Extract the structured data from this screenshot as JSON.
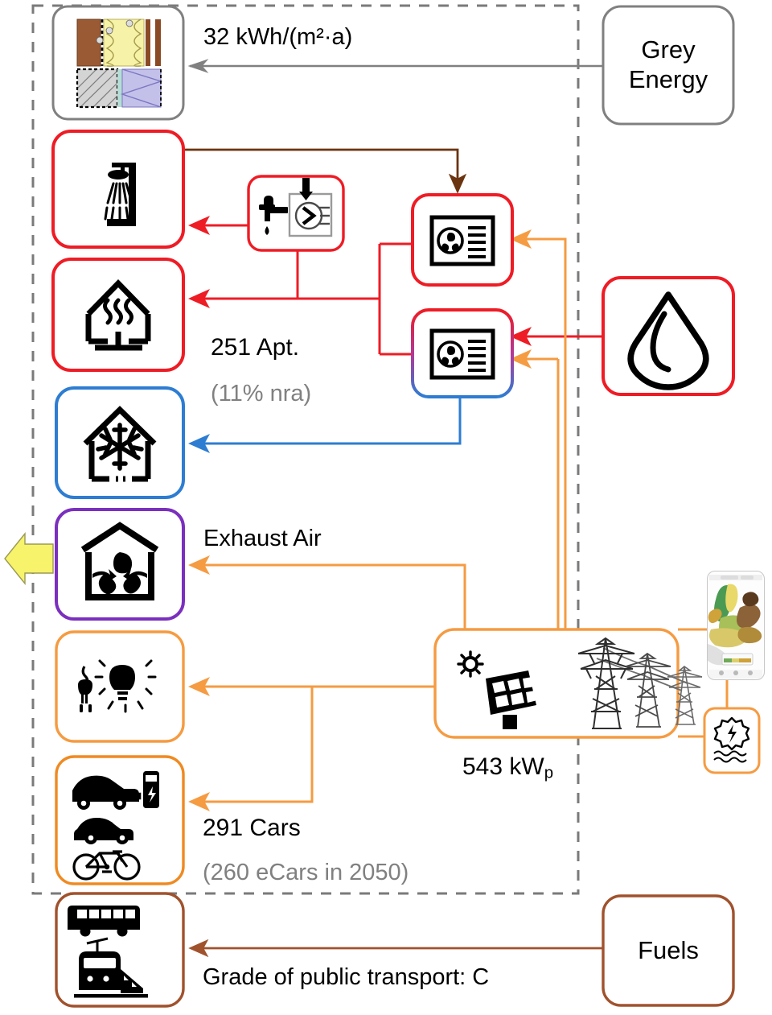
{
  "diagram": {
    "title": "Building energy and mobility flow diagram",
    "system_boundary": "dashed grey rectangle"
  },
  "colors": {
    "red": "#ee1c25",
    "blue": "#2d7dd2",
    "orange": "#f59b42",
    "orange_dark": "#ef8a22",
    "brown": "#a0522d",
    "brown_dark": "#6b3410",
    "purple": "#7b2fbe",
    "grey": "#808080",
    "grey_dash": "#7a7a7a",
    "yellow": "#f7f36b",
    "black": "#000000"
  },
  "labels": {
    "grey_energy_value": "32 kWh/(m²·a)",
    "apartments": "251 Apt.",
    "apartments_note": "(11% nra)",
    "exhaust_air": "Exhaust Air",
    "pv_power": "543 kW",
    "pv_power_sub": "p",
    "cars": "291 Cars",
    "cars_note": "(260 eCars in 2050)",
    "public_transport": "Grade of public transport: C"
  },
  "source_boxes": [
    {
      "id": "grey-energy",
      "label_line1": "Grey",
      "label_line2": "Energy",
      "color": "#808080"
    },
    {
      "id": "fuels",
      "label_line1": "Fuels",
      "label_line2": "",
      "color": "#a0522d"
    }
  ],
  "demand_boxes": [
    {
      "id": "building-envelope",
      "icon": "wall-section-icon",
      "border": "#808080",
      "name": "Building envelope construction"
    },
    {
      "id": "domestic-hot-water",
      "icon": "shower-icon",
      "border": "#ee1c25",
      "name": "Domestic hot water"
    },
    {
      "id": "space-heating",
      "icon": "house-heating-icon",
      "border": "#ee1c25",
      "name": "Space heating"
    },
    {
      "id": "space-cooling",
      "icon": "house-cooling-icon",
      "border": "#2d7dd2",
      "name": "Space cooling"
    },
    {
      "id": "ventilation",
      "icon": "house-fan-icon",
      "border": "#7b2fbe",
      "name": "Ventilation / exhaust air"
    },
    {
      "id": "appliances-lighting",
      "icon": "plug-bulb-icon",
      "border": "#f59b42",
      "name": "Appliances and lighting"
    },
    {
      "id": "private-mobility",
      "icon": "ecar-car-bike-icon",
      "border": "#ef8a22",
      "name": "Private mobility"
    },
    {
      "id": "public-mobility",
      "icon": "bus-train-icon",
      "border": "#a0522d",
      "name": "Public transport"
    }
  ],
  "plant_boxes": [
    {
      "id": "dhw-heat-recovery",
      "icon": "faucet-heat-exchanger-icon",
      "border": "#ee1c25",
      "name": "Hot water heat recovery unit"
    },
    {
      "id": "heat-pump-1",
      "icon": "heat-pump-icon",
      "border": "#ee1c25",
      "name": "Heat pump heating"
    },
    {
      "id": "heat-pump-2",
      "icon": "heat-pump-icon",
      "border": "gradient-red-blue",
      "name": "Reversible heat pump"
    },
    {
      "id": "water-source",
      "icon": "water-drop-icon",
      "border": "#ee1c25",
      "name": "Water / geothermal source"
    },
    {
      "id": "pv-system",
      "icon": "solar-panel-icon",
      "border": "#f59b42",
      "name": "Photovoltaic system"
    },
    {
      "id": "grid-hydro",
      "icon": "hydro-power-icon",
      "border": "#f59b42",
      "name": "Grid electricity / hydro power"
    }
  ],
  "decorations": [
    {
      "id": "power-towers",
      "name": "electricity-pylons-icon"
    },
    {
      "id": "map-phone",
      "name": "europe-map-phone-icon"
    },
    {
      "id": "export-arrow",
      "name": "yellow-export-arrow-icon"
    }
  ]
}
